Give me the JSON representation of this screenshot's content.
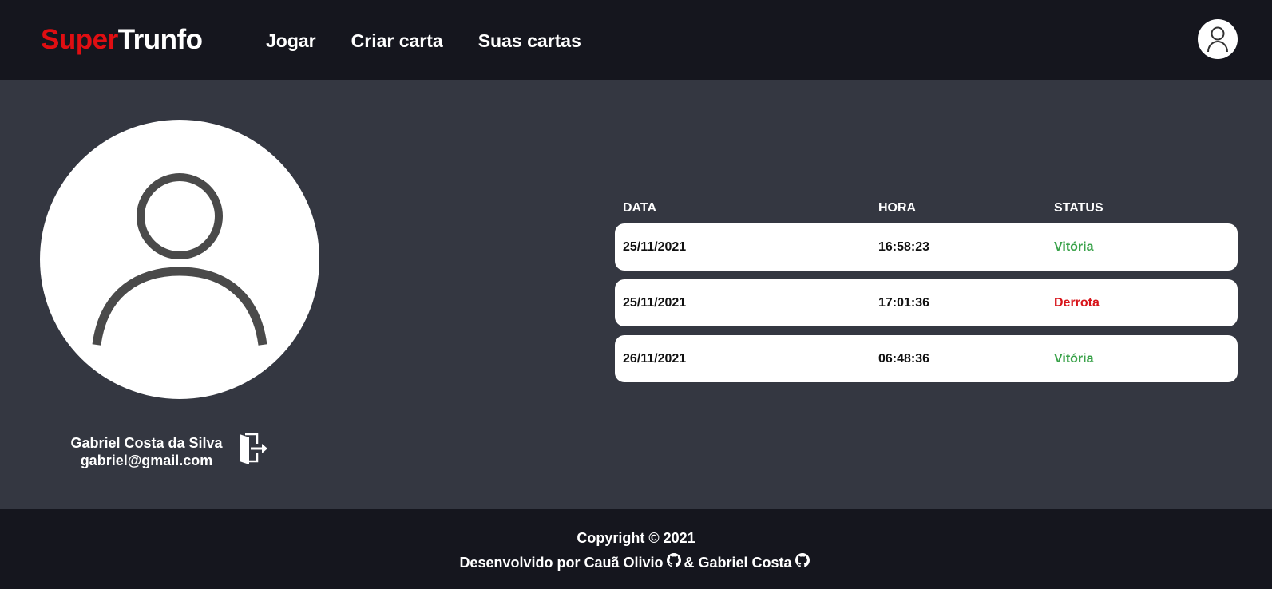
{
  "brand": {
    "part1": "Super",
    "part2": "Trunfo",
    "accent": "#e00e12"
  },
  "nav": {
    "items": [
      {
        "label": "Jogar"
      },
      {
        "label": "Criar carta"
      },
      {
        "label": "Suas cartas"
      }
    ]
  },
  "profile": {
    "name": "Gabriel Costa da Silva",
    "email": "gabriel@gmail.com"
  },
  "history": {
    "columns": [
      "DATA",
      "HORA",
      "STATUS"
    ],
    "rows": [
      {
        "date": "25/11/2021",
        "time": "16:58:23",
        "status": "Vitória"
      },
      {
        "date": "25/11/2021",
        "time": "17:01:36",
        "status": "Derrota"
      },
      {
        "date": "26/11/2021",
        "time": "06:48:36",
        "status": "Vitória"
      }
    ]
  },
  "footer": {
    "copyright": "Copyright © 2021",
    "prefix": "Desenvolvido por Cauã Olivio",
    "connector": "& Gabriel Costa"
  },
  "colors": {
    "header_bg": "#15161e",
    "main_bg": "#343741",
    "win": "#3aa24a",
    "loss": "#d8141a"
  },
  "icons": [
    "user-icon",
    "avatar-user-icon",
    "logout-door-icon",
    "github-icon"
  ]
}
